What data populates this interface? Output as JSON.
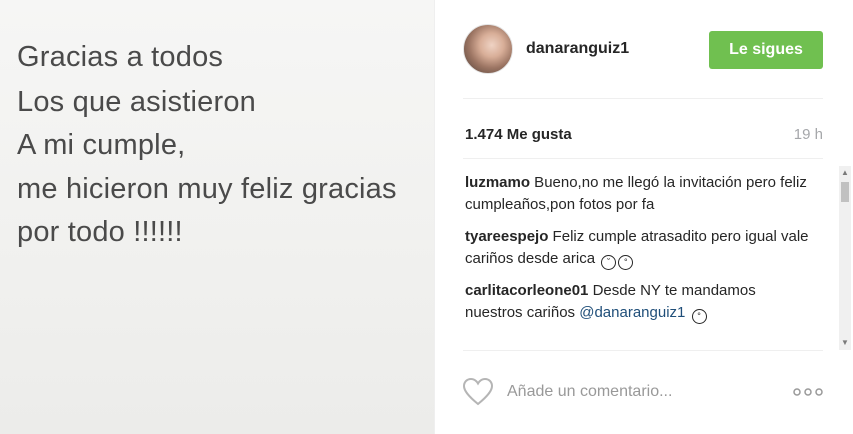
{
  "photo": {
    "lines": [
      "Gracias a todos",
      "Los que asistieron",
      "A mi cumple,",
      "me hicieron muy feliz gracias",
      "por todo !!!!!!"
    ]
  },
  "header": {
    "username": "danaranguiz1",
    "follow_label": "Le sigues"
  },
  "stats": {
    "likes": "1.474 Me gusta",
    "time": "19 h"
  },
  "comments": [
    {
      "author": "luzmamo",
      "text": " Bueno,no me llegó la invitación pero feliz cumpleaños,pon fotos por fa"
    },
    {
      "author": "tyareespejo",
      "text": " Feliz cumple atrasadito pero igual vale cariños desde arica"
    },
    {
      "author": "carlitacorleone01",
      "text": " Desde NY te mandamos nuestros cariños ",
      "mention": "@danaranguiz1"
    }
  ],
  "comment_box": {
    "placeholder": "Añade un comentario..."
  },
  "icons": {
    "like": "heart-icon",
    "more": "more-options-icon",
    "emoji": "emoji-icon"
  },
  "colors": {
    "follow_button": "#70c050",
    "mention": "#1f4e79",
    "muted": "#a5a7aa"
  }
}
